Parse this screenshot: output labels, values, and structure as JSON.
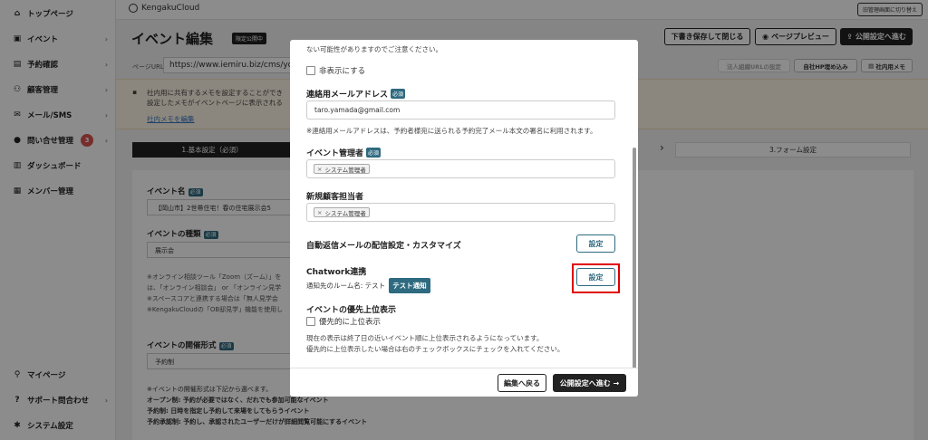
{
  "sidebar": {
    "items": [
      {
        "label": "トップページ",
        "icon": "home-icon"
      },
      {
        "label": "イベント",
        "icon": "document-icon"
      },
      {
        "label": "予約確認",
        "icon": "inbox-icon"
      },
      {
        "label": "顧客管理",
        "icon": "users-icon"
      },
      {
        "label": "メール/SMS",
        "icon": "mail-icon"
      },
      {
        "label": "問い合せ管理",
        "icon": "chat-icon",
        "badge": "3"
      },
      {
        "label": "ダッシュボード",
        "icon": "chart-icon"
      },
      {
        "label": "メンバー管理",
        "icon": "grid-icon"
      }
    ],
    "bottom": [
      {
        "label": "マイページ",
        "icon": "person-icon"
      },
      {
        "label": "サポート問合わせ",
        "icon": "help-icon"
      },
      {
        "label": "システム設定",
        "icon": "gear-icon"
      }
    ]
  },
  "topbar": {
    "logo": "KengakuCloud",
    "admin_button": "旧管理画面に切り替え"
  },
  "page": {
    "title": "イベント編集",
    "limited_badge": "限定公開中",
    "save_close": "下書き保存して閉じる",
    "preview": "ページプレビュー",
    "publish": "公開設定へ進む",
    "url_label": "ページURL",
    "url_value": "https://www.iemiru.biz/cms/yo",
    "corp_url_btn": "法人組織URLの設定",
    "embed_btn": "自社HP埋め込み",
    "memo_btn": "社内用メモ",
    "memo_line1": "社内用に共有するメモを設定することができ",
    "memo_line2": "設定したメモがイベントページに表示される",
    "memo_link": "社内メモを編集",
    "step1": "1.基本設定（必須）",
    "step3": "3.フォーム設定",
    "event_name_label": "イベント名",
    "event_name_value": "【岡山市】2世帯住宅！春の住宅展示会5",
    "event_type_label": "イベントの種類",
    "event_type_value": "展示会",
    "note1": "※オンライン相談ツール「Zoom（ズーム）」を",
    "note2": "は、「オンライン相談会」 or 「オンライン見学",
    "note3": "※スペースコアと連携する場合は「無人見学会",
    "note4": "※KengakuCloudの「OB邸見学」機能を使用し",
    "format_label": "イベントの開催形式",
    "format_value": "予約制",
    "format_note0": "※イベントの開催形式は下記から選べます。",
    "format_note1": "オープン制: 予約が必要ではなく、だれでも参加可能なイベント",
    "format_note2": "予約制: 日時を指定し予約して来場をしてもらうイベント",
    "format_note3": "予約承認制: 予約し、承認されたユーザーだけが詳細閲覧可能にするイベント",
    "required": "必須"
  },
  "modal": {
    "top_note": "ない可能性がありますのでご注意ください。",
    "hide_label": "非表示にする",
    "contact_email_label": "連絡用メールアドレス",
    "contact_email_value": "taro.yamada@gmail.com",
    "contact_email_note": "※連絡用メールアドレスは、予約者様宛に送られる予約完了メール本文の署名に利用されます。",
    "event_manager_label": "イベント管理者",
    "event_manager_tag": "システム管理者",
    "new_customer_label": "新規顧客担当者",
    "new_customer_tag": "システム管理者",
    "auto_reply_label": "自動返信メールの配信設定・カスタマイズ",
    "settings_button": "設定",
    "chatwork_label": "Chatwork連携",
    "room_label": "通知先のルーム名: テスト",
    "test_button": "テスト通知",
    "priority_label": "イベントの優先上位表示",
    "priority_check": "優先的に上位表示",
    "priority_note1": "現在の表示は終了日の近いイベント順に上位表示されるようになっています。",
    "priority_note2": "優先的に上位表示したい場合は右のチェックボックスにチェックを入れてください。",
    "back_button": "編集へ戻る",
    "next_button": "公開設定へ進む →",
    "required": "必須"
  }
}
